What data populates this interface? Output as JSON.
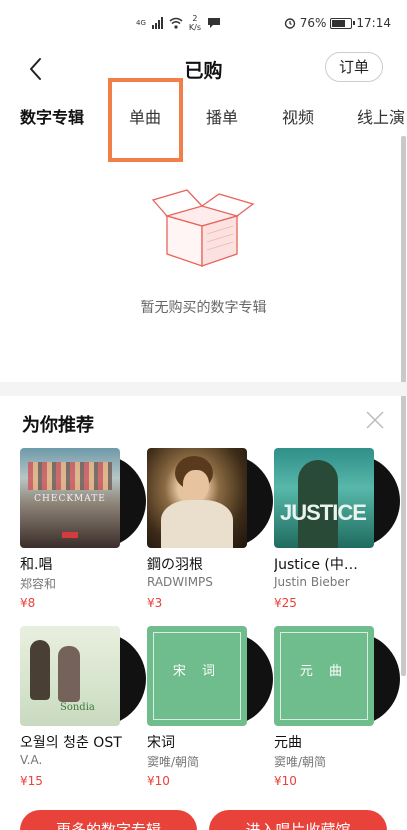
{
  "status_bar": {
    "network": "4G",
    "speed_value": "2",
    "speed_unit": "K/s",
    "battery_percent": "76%",
    "battery_level": 0.76,
    "time": "17:14"
  },
  "header": {
    "title": "已购",
    "order_button": "订单"
  },
  "tabs": [
    {
      "label": "数字专辑",
      "active": true
    },
    {
      "label": "单曲",
      "active": false
    },
    {
      "label": "播单",
      "active": false
    },
    {
      "label": "视频",
      "active": false
    },
    {
      "label": "线上演",
      "active": false
    }
  ],
  "empty_state": {
    "message": "暂无购买的数字专辑"
  },
  "recommend": {
    "title": "为你推荐",
    "items": [
      {
        "name": "和.唱",
        "artist": "郑容和",
        "price": "¥8",
        "cover_text": "CHECKMATE"
      },
      {
        "name": "鋼の羽根",
        "artist": "RADWIMPS",
        "price": "¥3"
      },
      {
        "name": "Justice (中…",
        "artist": "Justin Bieber",
        "price": "¥25",
        "cover_text": "JUSTICE"
      },
      {
        "name": "오월의 청춘 OST",
        "artist": "V.A.",
        "price": "¥15",
        "cover_text": "Sondia"
      },
      {
        "name": "宋词",
        "artist": "窦唯/朝简",
        "price": "¥10",
        "cover_text": "宋 词"
      },
      {
        "name": "元曲",
        "artist": "窦唯/朝简",
        "price": "¥10",
        "cover_text": "元 曲"
      }
    ]
  },
  "bottom_buttons": {
    "left": "更多的数字专辑",
    "right": "进入唱片收藏馆"
  },
  "colors": {
    "accent": "#e8423b",
    "highlight_box": "#f08047"
  }
}
